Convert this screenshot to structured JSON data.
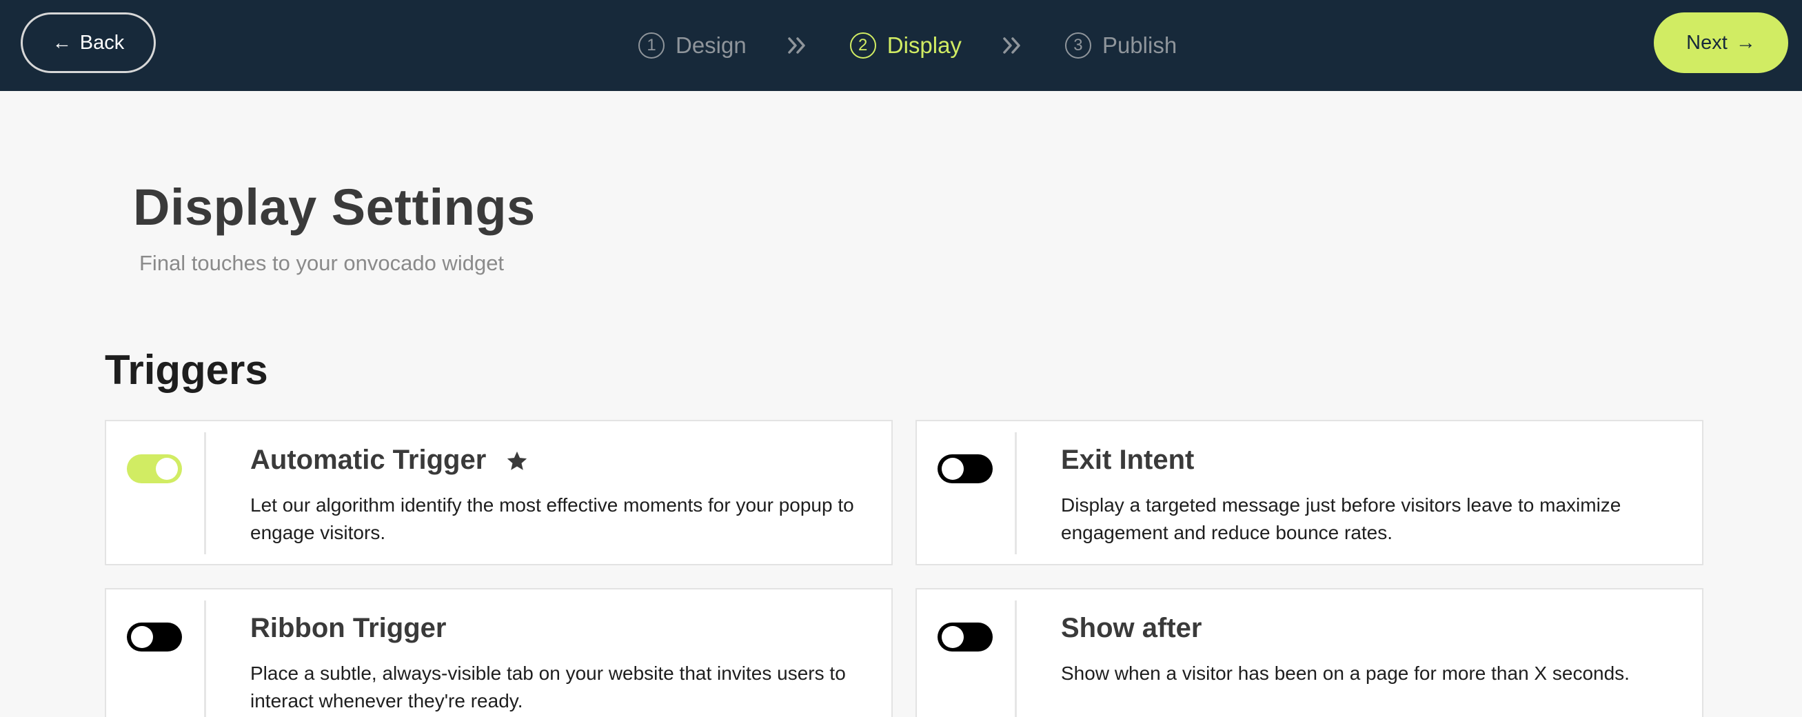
{
  "header": {
    "back_label": "Back",
    "next_label": "Next",
    "steps": [
      {
        "number": "1",
        "label": "Design",
        "active": false
      },
      {
        "number": "2",
        "label": "Display",
        "active": true
      },
      {
        "number": "3",
        "label": "Publish",
        "active": false
      }
    ]
  },
  "page": {
    "title": "Display Settings",
    "subtitle": "Final touches to your onvocado widget"
  },
  "triggers": {
    "section_title": "Triggers",
    "items": [
      {
        "title": "Automatic Trigger",
        "description": "Let our algorithm identify the most effective moments for your popup to engage visitors.",
        "enabled": true,
        "starred": true
      },
      {
        "title": "Exit Intent",
        "description": "Display a targeted message just before visitors leave to maximize engagement and reduce bounce rates.",
        "enabled": false,
        "starred": false
      },
      {
        "title": "Ribbon Trigger",
        "description": "Place a subtle, always-visible tab on your website that invites users to interact whenever they're ready.",
        "enabled": false,
        "starred": false
      },
      {
        "title": "Show after",
        "description": "Show when a visitor has been on a page for more than X seconds.",
        "enabled": false,
        "starred": false
      }
    ]
  },
  "colors": {
    "topbar_bg": "#17293a",
    "accent": "#d1ec63",
    "toggle_off": "#000000"
  },
  "icons": {
    "back": "arrow-left-icon",
    "next": "arrow-right-icon",
    "step_separator": "double-chevron-right-icon",
    "featured": "star-icon"
  }
}
